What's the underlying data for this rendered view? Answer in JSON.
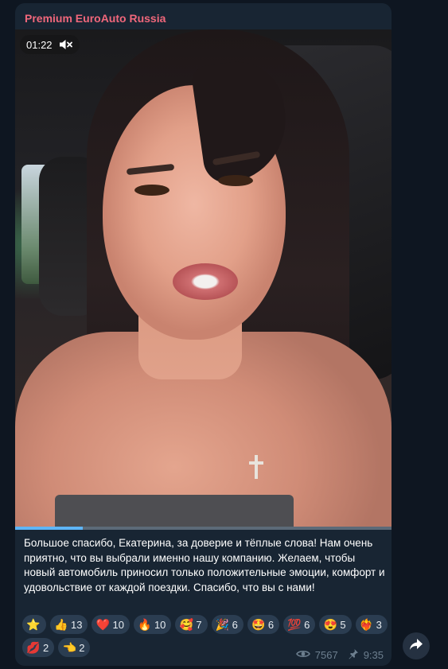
{
  "channel": {
    "name": "Premium EuroAuto Russia",
    "name_color": "#f0677b"
  },
  "video": {
    "time": "01:22",
    "muted_icon": "muted-speaker-icon",
    "progress": 0.18
  },
  "message": {
    "text": "Большое спасибо, Екатерина, за доверие и тёплые слова! Нам очень приятно, что вы выбрали именно нашу компанию. Желаем, чтобы новый автомобиль приносил только положительные эмоции, комфорт и удовольствие от каждой поездки. Спасибо, что вы с нами!"
  },
  "reactions": [
    {
      "icon": "star-icon",
      "glyph": "⭐",
      "count": ""
    },
    {
      "icon": "thumbs-up-icon",
      "glyph": "👍",
      "count": "13"
    },
    {
      "icon": "heart-icon",
      "glyph": "❤️",
      "count": "10"
    },
    {
      "icon": "fire-icon",
      "glyph": "🔥",
      "count": "10"
    },
    {
      "icon": "smiling-face-with-hearts-icon",
      "glyph": "🥰",
      "count": "7"
    },
    {
      "icon": "party-popper-icon",
      "glyph": "🎉",
      "count": "6"
    },
    {
      "icon": "star-struck-icon",
      "glyph": "🤩",
      "count": "6"
    },
    {
      "icon": "hundred-points-icon",
      "glyph": "💯",
      "count": "6"
    },
    {
      "icon": "heart-eyes-icon",
      "glyph": "😍",
      "count": "5"
    },
    {
      "icon": "heart-on-fire-icon",
      "glyph": "❤️‍🔥",
      "count": "3"
    },
    {
      "icon": "kiss-mark-icon",
      "glyph": "💋",
      "count": "2"
    },
    {
      "icon": "pointing-hand-icon",
      "glyph": "👈",
      "count": "2"
    }
  ],
  "meta": {
    "views": "7567",
    "time": "9:35",
    "eye_icon": "eye-icon",
    "pin_icon": "pin-icon"
  },
  "share_icon": "share-arrow-icon",
  "colors": {
    "background": "#0e1621",
    "bubble": "#182533",
    "reaction_bg": "#2b3d51",
    "accent": "#5eb5f7"
  }
}
